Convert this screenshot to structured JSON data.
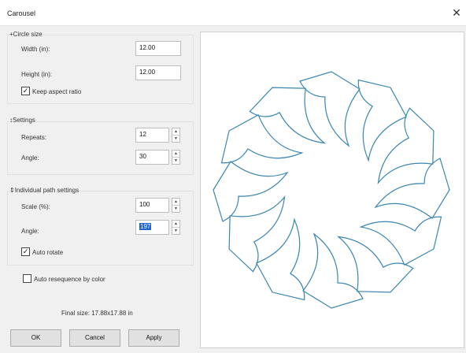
{
  "window": {
    "title": "Carousel"
  },
  "circle_size": {
    "title": "+Circle size",
    "width_label": "Width (in):",
    "width_value": "12.00",
    "height_label": "Height (in):",
    "height_value": "12.00",
    "keep_aspect_label": "Keep aspect ratio",
    "keep_aspect_checked": true
  },
  "settings": {
    "title": "↕Settings",
    "repeats_label": "Repeats:",
    "repeats_value": "12",
    "angle_label": "Angle:",
    "angle_value": "30"
  },
  "individual": {
    "title": "⇕Individual path settings",
    "scale_label": "Scale (%):",
    "scale_value": "100",
    "angle_label": "Angle:",
    "angle_value": "197",
    "auto_rotate_label": "Auto rotate",
    "auto_rotate_checked": true
  },
  "auto_resequence": {
    "label": "Auto resequence by color",
    "checked": false
  },
  "final_size": "Final size: 17.88x17.88 in",
  "buttons": {
    "ok": "OK",
    "cancel": "Cancel",
    "apply": "Apply"
  },
  "colors": {
    "stroke": "#3a86b0",
    "selection": "#1e63d6"
  }
}
